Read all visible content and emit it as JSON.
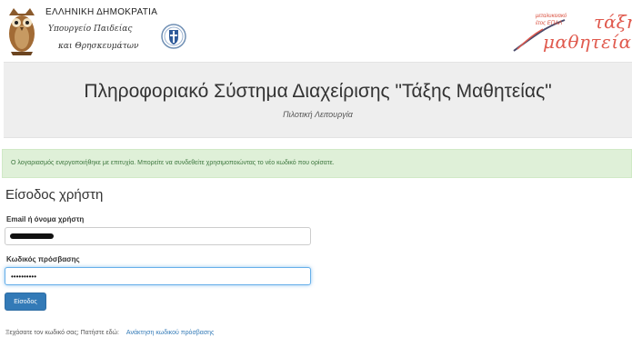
{
  "header": {
    "gov_title": "ΕΛΛΗΝΙΚΗ ΔΗΜΟΚΡΑΤΙΑ",
    "ministry_line1": "Υπουργείο Παιδείας",
    "ministry_line2": "και Θρησκευμάτων",
    "apprenticeship_logo": {
      "small_line1": "μεταλυκειακό",
      "small_line2": "έτος ΕΠΑΛ",
      "word1": "τάξη",
      "word2": "μαθητείας",
      "color": "#e05a4e"
    }
  },
  "banner": {
    "title": "Πληροφοριακό Σύστημα Διαχείρισης \"Τάξης Μαθητείας\"",
    "subtitle": "Πιλοτική Λειτουργία"
  },
  "alert": {
    "message": "Ο λογαριασμός ενεργοποιήθηκε με επιτυχία. Μπορείτε να συνδεθείτε χρησιμοποιώντας το νέο κωδικό που ορίσατε.",
    "color": "#3c763d",
    "background": "#dff0d8"
  },
  "login": {
    "heading": "Είσοδος χρήστη",
    "email_label": "Email ή όνομα χρήστη",
    "password_label": "Κωδικός πρόσβασης",
    "password_value": "••••••••••",
    "submit_label": "Είσοδος",
    "forgot_text": "Ξεχάσατε τον κωδικό σας; Πατήστε εδώ:",
    "forgot_link": "Ανάκτηση κωδικού πρόσβασης",
    "accent_color": "#337ab7"
  }
}
